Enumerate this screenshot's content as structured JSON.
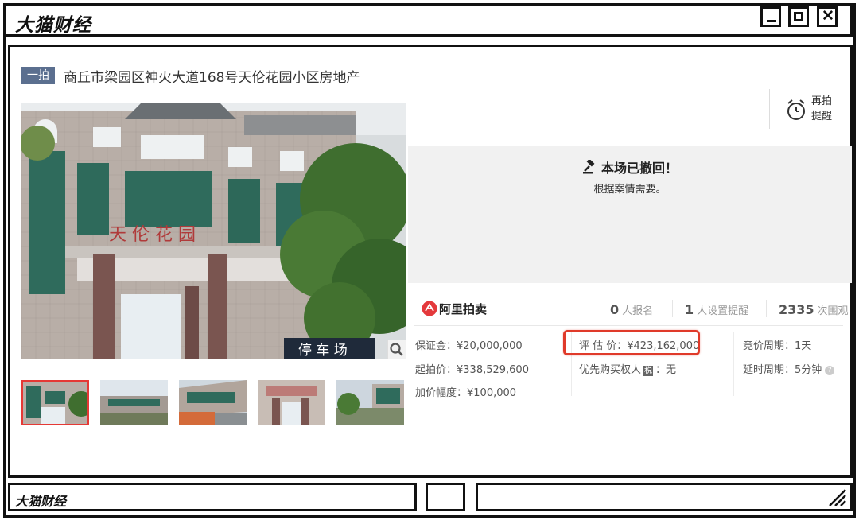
{
  "window": {
    "title": "大猫财经",
    "footer_title": "大猫财经"
  },
  "listing": {
    "badge": "一拍",
    "headline": "商丘市梁园区神火大道168号天伦花园小区房地产"
  },
  "remind": {
    "label_line1": "再拍",
    "label_line2": "提醒"
  },
  "status": {
    "title": "本场已撤回！",
    "reason": "根据案情需要。"
  },
  "platform": {
    "name": "阿里拍卖",
    "logo_color": "#e4393c"
  },
  "stats": {
    "registrations": {
      "count": "0",
      "label": "人报名"
    },
    "reminders": {
      "count": "1",
      "label": "人设置提醒"
    },
    "views": {
      "count": "2335",
      "label": "次围观"
    }
  },
  "details": {
    "deposit": "保证金：¥20,000,000",
    "start_price": "起拍价：¥338,529,600",
    "increment": "加价幅度：¥100,000",
    "appraisal": "评 估 价：¥423,162,000",
    "priority_label": "优先购买权人",
    "priority_tag": "税",
    "priority_value": "：无",
    "bid_cycle": "竞价周期：1天",
    "delay_cycle": "延时周期：5分钟"
  },
  "colors": {
    "badge_bg": "#5b6f8f",
    "highlight": "#e03a2a",
    "panel_bg": "#f1f1f1"
  }
}
